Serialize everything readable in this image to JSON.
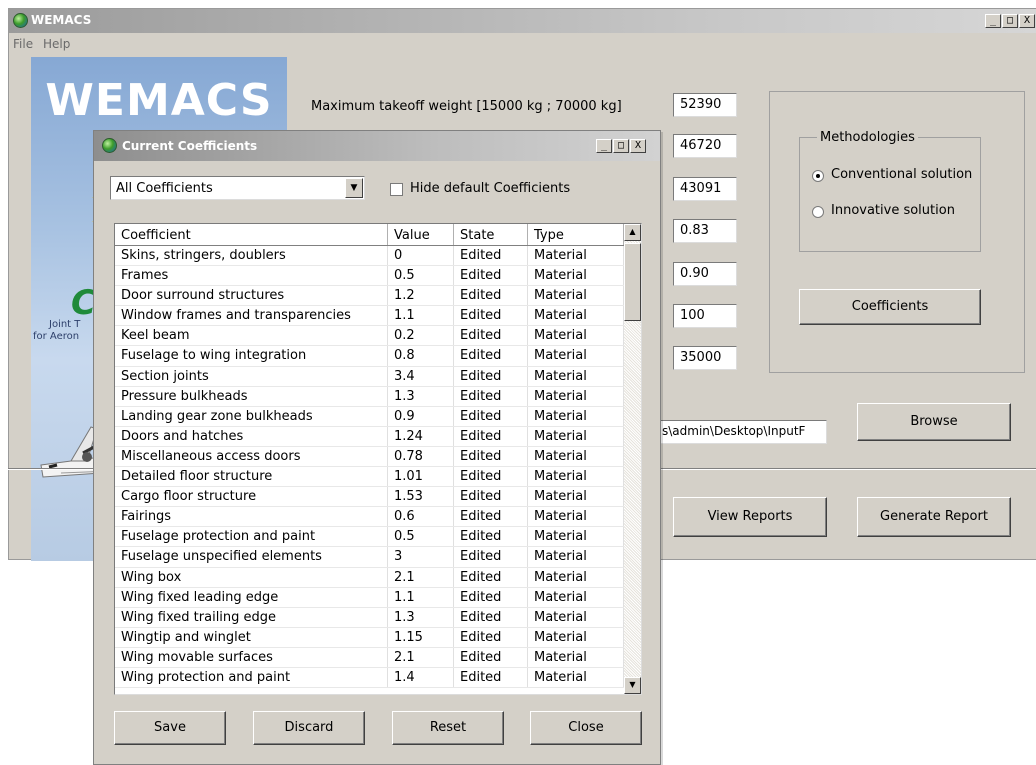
{
  "app": {
    "title": "WEMACS",
    "menu": [
      "File",
      "Help"
    ],
    "title_buttons": [
      "_",
      "□",
      "X"
    ]
  },
  "banner": {
    "title": "WEMACS",
    "logo_partial": "CL",
    "line1_partial": "Joint T",
    "line2_partial": "for Aeron"
  },
  "form": {
    "mtow_label": "Maximum takeoff weight  [15000 kg ; 70000 kg]",
    "values": [
      "52390",
      "46720",
      "43091",
      "0.83",
      "0.90",
      "100",
      "35000"
    ],
    "path_value": "s\\admin\\Desktop\\InputF",
    "methodologies": {
      "legend": "Methodologies",
      "options": [
        "Conventional solution",
        "Innovative solution"
      ],
      "selected": "Conventional solution"
    },
    "coefficients_button": "Coefficients",
    "browse_button": "Browse",
    "view_reports_button": "View Reports",
    "generate_report_button": "Generate Report"
  },
  "dialog": {
    "title": "Current Coefficients",
    "filter_value": "All Coefficients",
    "hide_default_label": "Hide default Coefficients",
    "hide_default_checked": false,
    "columns": [
      "Coefficient",
      "Value",
      "State",
      "Type"
    ],
    "rows": [
      [
        "Skins, stringers, doublers",
        "0",
        "Edited",
        "Material"
      ],
      [
        "Frames",
        "0.5",
        "Edited",
        "Material"
      ],
      [
        "Door surround structures",
        "1.2",
        "Edited",
        "Material"
      ],
      [
        "Window frames and transparencies",
        "1.1",
        "Edited",
        "Material"
      ],
      [
        "Keel beam",
        "0.2",
        "Edited",
        "Material"
      ],
      [
        "Fuselage to wing integration",
        "0.8",
        "Edited",
        "Material"
      ],
      [
        "Section joints",
        "3.4",
        "Edited",
        "Material"
      ],
      [
        "Pressure bulkheads",
        "1.3",
        "Edited",
        "Material"
      ],
      [
        "Landing gear zone bulkheads",
        "0.9",
        "Edited",
        "Material"
      ],
      [
        "Doors and hatches",
        "1.24",
        "Edited",
        "Material"
      ],
      [
        "Miscellaneous access doors",
        "0.78",
        "Edited",
        "Material"
      ],
      [
        "Detailed floor structure",
        "1.01",
        "Edited",
        "Material"
      ],
      [
        "Cargo floor structure",
        "1.53",
        "Edited",
        "Material"
      ],
      [
        "Fairings",
        "0.6",
        "Edited",
        "Material"
      ],
      [
        "Fuselage protection and paint",
        "0.5",
        "Edited",
        "Material"
      ],
      [
        "Fuselage unspecified elements",
        "3",
        "Edited",
        "Material"
      ],
      [
        "Wing box",
        "2.1",
        "Edited",
        "Material"
      ],
      [
        "Wing fixed leading edge",
        "1.1",
        "Edited",
        "Material"
      ],
      [
        "Wing fixed trailing edge",
        "1.3",
        "Edited",
        "Material"
      ],
      [
        "Wingtip and winglet",
        "1.15",
        "Edited",
        "Material"
      ],
      [
        "Wing movable surfaces",
        "2.1",
        "Edited",
        "Material"
      ],
      [
        "Wing protection and paint",
        "1.4",
        "Edited",
        "Material"
      ]
    ],
    "buttons": {
      "save": "Save",
      "discard": "Discard",
      "reset": "Reset",
      "close": "Close"
    }
  }
}
